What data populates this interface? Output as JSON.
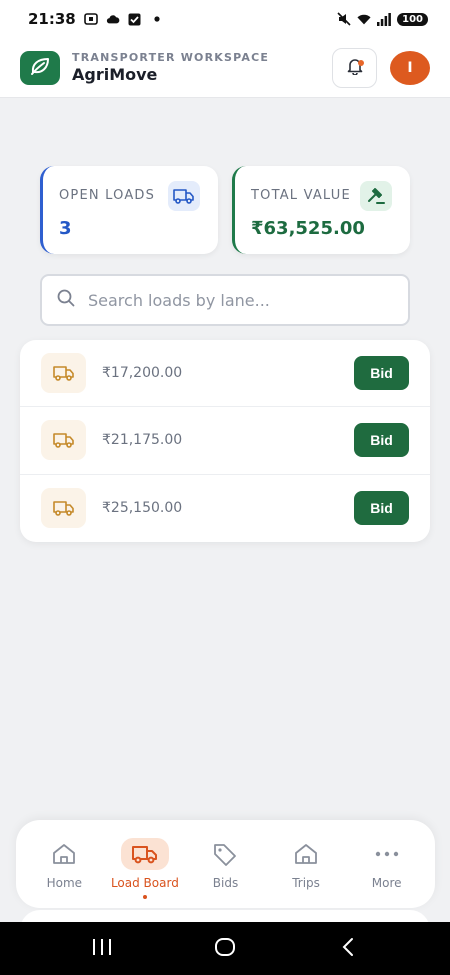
{
  "status_bar": {
    "time": "21:38",
    "battery": "100",
    "icons": [
      "screenshot-icon",
      "cloud-icon",
      "check-box-icon",
      "dot-icon",
      "mute-icon",
      "wifi-icon",
      "signal-icon"
    ]
  },
  "header": {
    "subtitle": "TRANSPORTER WORKSPACE",
    "title": "AgriMove",
    "avatar_initial": "I",
    "logo_icon": "leaf-icon",
    "bell_icon": "bell-icon"
  },
  "summary": {
    "open_loads": {
      "label": "OPEN LOADS",
      "value": "3",
      "icon": "truck-icon"
    },
    "total_value": {
      "label": "TOTAL VALUE",
      "value": "₹63,525.00",
      "icon": "gavel-icon"
    }
  },
  "search": {
    "placeholder": "Search loads by lane...",
    "value": ""
  },
  "loads": [
    {
      "price": "₹17,200.00",
      "action": "Bid"
    },
    {
      "price": "₹21,175.00",
      "action": "Bid"
    },
    {
      "price": "₹25,150.00",
      "action": "Bid"
    }
  ],
  "bottom_nav": [
    {
      "label": "Home",
      "icon": "home-icon",
      "active": false
    },
    {
      "label": "Load Board",
      "icon": "truck-icon",
      "active": true
    },
    {
      "label": "Bids",
      "icon": "tag-icon",
      "active": false
    },
    {
      "label": "Trips",
      "icon": "home-icon",
      "active": false
    },
    {
      "label": "More",
      "icon": "more-icon",
      "active": false
    }
  ],
  "colors": {
    "brand_green": "#1f7a4a",
    "accent_orange": "#d9531e",
    "accent_blue": "#2458c6",
    "bid_button": "#1f6b3f"
  }
}
